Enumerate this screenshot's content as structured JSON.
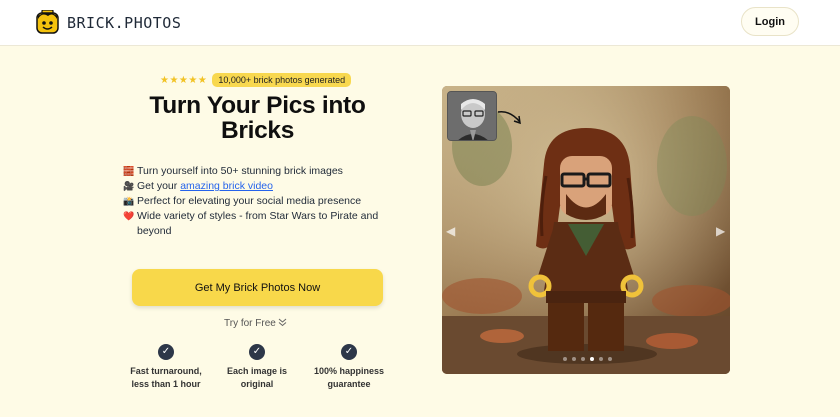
{
  "nav": {
    "brand": "BRICK.PHOTOS",
    "login_label": "Login"
  },
  "hero": {
    "stars": "★★★★★",
    "rating_value": 5,
    "badge": "10,000+ brick photos generated",
    "headline": "Turn Your Pics into Bricks",
    "features": [
      {
        "icon": "brick-icon",
        "emoji": "🧱",
        "text": "Turn yourself into 50+ stunning brick images"
      },
      {
        "icon": "film-icon",
        "emoji": "🎥",
        "text_before": "Get your ",
        "link": "amazing brick video"
      },
      {
        "icon": "camera-icon",
        "emoji": "📸",
        "text": "Perfect for elevating your social media presence"
      },
      {
        "icon": "heart-icon",
        "emoji": "❤️",
        "text": "Wide variety of styles - from Star Wars to Pirate and beyond"
      }
    ],
    "cta_label": "Get My Brick Photos Now",
    "try_free": "Try for Free",
    "perks": [
      {
        "line1": "Fast turnaround,",
        "line2": "less than 1 hour"
      },
      {
        "line1": "Each image is",
        "line2": "original"
      },
      {
        "line1": "100% happiness",
        "line2": "guarantee"
      }
    ]
  },
  "carousel": {
    "slide_count": 6,
    "active_index": 3
  },
  "colors": {
    "background": "#fefbe6",
    "accent": "#f8d84a",
    "badge": "#f8d84f",
    "link": "#2563eb",
    "check": "#2d3748"
  }
}
